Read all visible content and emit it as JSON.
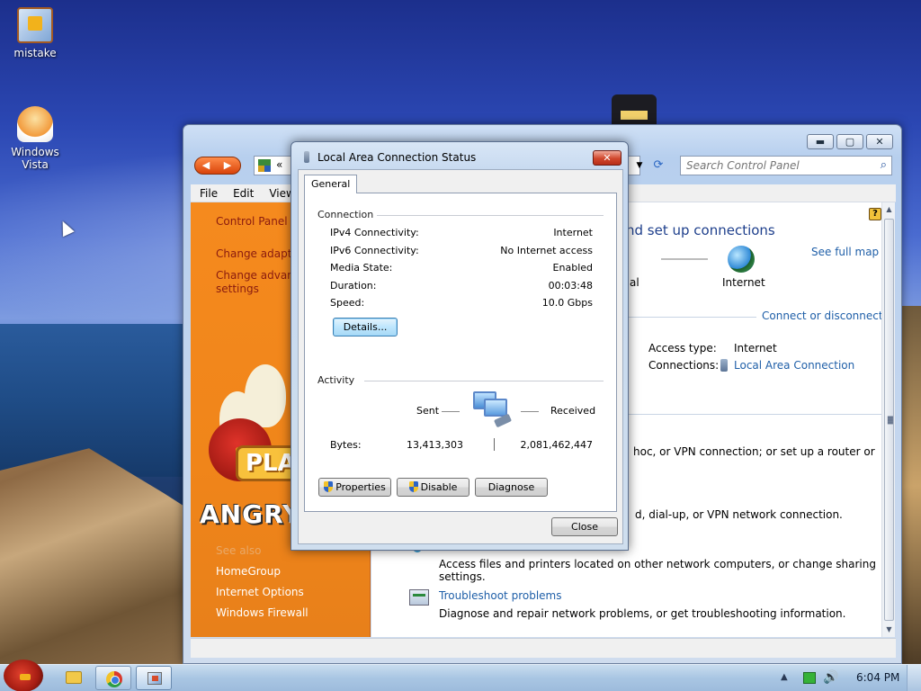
{
  "desktop": {
    "icons": [
      {
        "label": "mistake"
      },
      {
        "label": "Windows Vista"
      }
    ]
  },
  "control_panel": {
    "nav_back": "◀",
    "nav_forward": "▶",
    "address_chevron": "«",
    "address_drop": "▼",
    "refresh": "⟳",
    "search_placeholder": "Search Control Panel",
    "search_glyph": "⌕",
    "menu": [
      "File",
      "Edit",
      "View"
    ],
    "window_buttons": {
      "minimize": "▬",
      "maximize": "▢",
      "close": "✕"
    },
    "left_links": {
      "home": "Control Panel H",
      "change_adapter": "Change adapter",
      "change_advanced_1": "Change advanc",
      "change_advanced_2": "settings",
      "see_also": "See also",
      "homegroup": "HomeGroup",
      "internet_options": "Internet Options",
      "windows_firewall": "Windows Firewall"
    },
    "art": {
      "play": "PLA",
      "angry": "ANGRY"
    },
    "main": {
      "heading_fragment": "nd set up connections",
      "see_full_map": "See full map",
      "internet_label": "Internet",
      "l_fragment": "al",
      "connect_or_disconnect": "Connect or disconnect",
      "access_type_label": "Access type:",
      "access_type_value": "Internet",
      "connections_label": "Connections:",
      "connections_value": "Local Area Connection",
      "fragment_adhoc": "hoc, or VPN connection; or set up a router or",
      "fragment_dialup": "d, dial-up, or VPN network connection.",
      "share_desc": "Access files and printers located on other network computers, or change sharing settings.",
      "troubleshoot_link": "Troubleshoot problems",
      "troubleshoot_desc": "Diagnose and repair network problems, or get troubleshooting information.",
      "help_glyph": "?"
    }
  },
  "dialog": {
    "title": "Local Area Connection Status",
    "close_glyph": "✕",
    "tab": "General",
    "connection_group": "Connection",
    "rows": [
      {
        "label": "IPv4 Connectivity:",
        "value": "Internet"
      },
      {
        "label": "IPv6 Connectivity:",
        "value": "No Internet access"
      },
      {
        "label": "Media State:",
        "value": "Enabled"
      },
      {
        "label": "Duration:",
        "value": "00:03:48"
      },
      {
        "label": "Speed:",
        "value": "10.0 Gbps"
      }
    ],
    "details_button": "Details...",
    "activity_group": "Activity",
    "sent_label": "Sent",
    "received_label": "Received",
    "bytes_label": "Bytes:",
    "bytes_sent": "13,413,303",
    "bytes_received": "2,081,462,447",
    "properties_button": "Properties",
    "disable_button": "Disable",
    "diagnose_button": "Diagnose",
    "close_button": "Close"
  },
  "taskbar": {
    "tray_arrow": "▲",
    "volume_glyph": "🔊",
    "clock": "6:04 PM"
  }
}
